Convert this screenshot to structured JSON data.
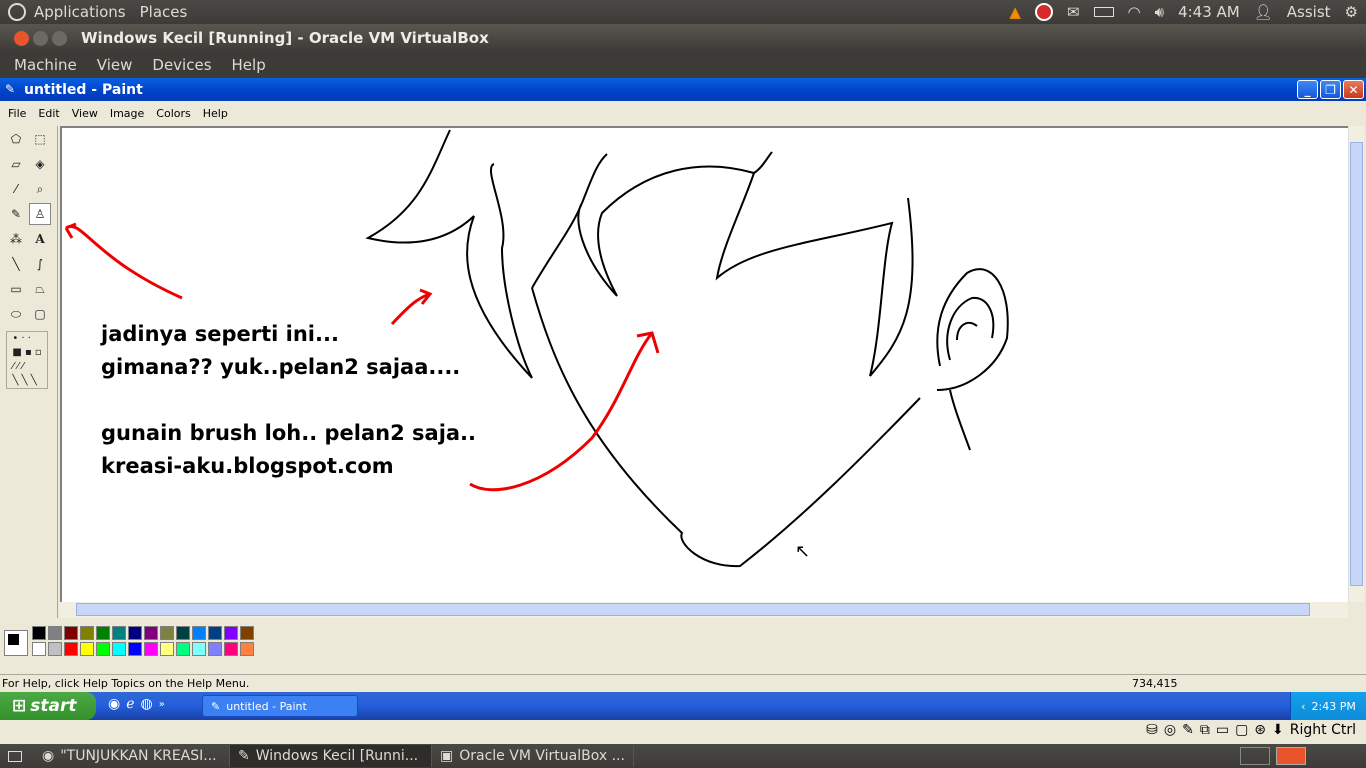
{
  "top_panel": {
    "menus": [
      "Applications",
      "Places"
    ],
    "clock": "4:43 AM",
    "user": "Assist",
    "icons": [
      "vlc-icon",
      "stop-icon",
      "mail-icon",
      "battery-icon",
      "wifi-icon",
      "volume-icon"
    ]
  },
  "vbox": {
    "title": "Windows Kecil [Running] - Oracle VM VirtualBox",
    "menu": [
      "Machine",
      "View",
      "Devices",
      "Help"
    ],
    "host_key": "Right Ctrl"
  },
  "paint": {
    "title": "untitled - Paint",
    "menu": [
      "File",
      "Edit",
      "View",
      "Image",
      "Colors",
      "Help"
    ],
    "canvas_text": [
      "jadinya seperti ini...",
      "gimana?? yuk..pelan2 sajaa....",
      "gunain brush loh.. pelan2 saja..",
      "kreasi-aku.blogspot.com"
    ],
    "status_help": "For Help, click Help Topics on the Help Menu.",
    "status_coords": "734,415",
    "palette_top": [
      "#000000",
      "#808080",
      "#800000",
      "#808000",
      "#008000",
      "#008080",
      "#000080",
      "#800080",
      "#808040",
      "#004040",
      "#0080ff",
      "#004080",
      "#8000ff",
      "#804000"
    ],
    "palette_bottom": [
      "#ffffff",
      "#c0c0c0",
      "#ff0000",
      "#ffff00",
      "#00ff00",
      "#00ffff",
      "#0000ff",
      "#ff00ff",
      "#ffff80",
      "#00ff80",
      "#80ffff",
      "#8080ff",
      "#ff0080",
      "#ff8040"
    ]
  },
  "xp_taskbar": {
    "start": "start",
    "task": "untitled - Paint",
    "clock": "2:43 PM"
  },
  "bottom_panel": {
    "tasks": [
      "\"TUNJUKKAN KREASI...",
      "Windows Kecil [Runni...",
      "Oracle VM VirtualBox ..."
    ]
  }
}
